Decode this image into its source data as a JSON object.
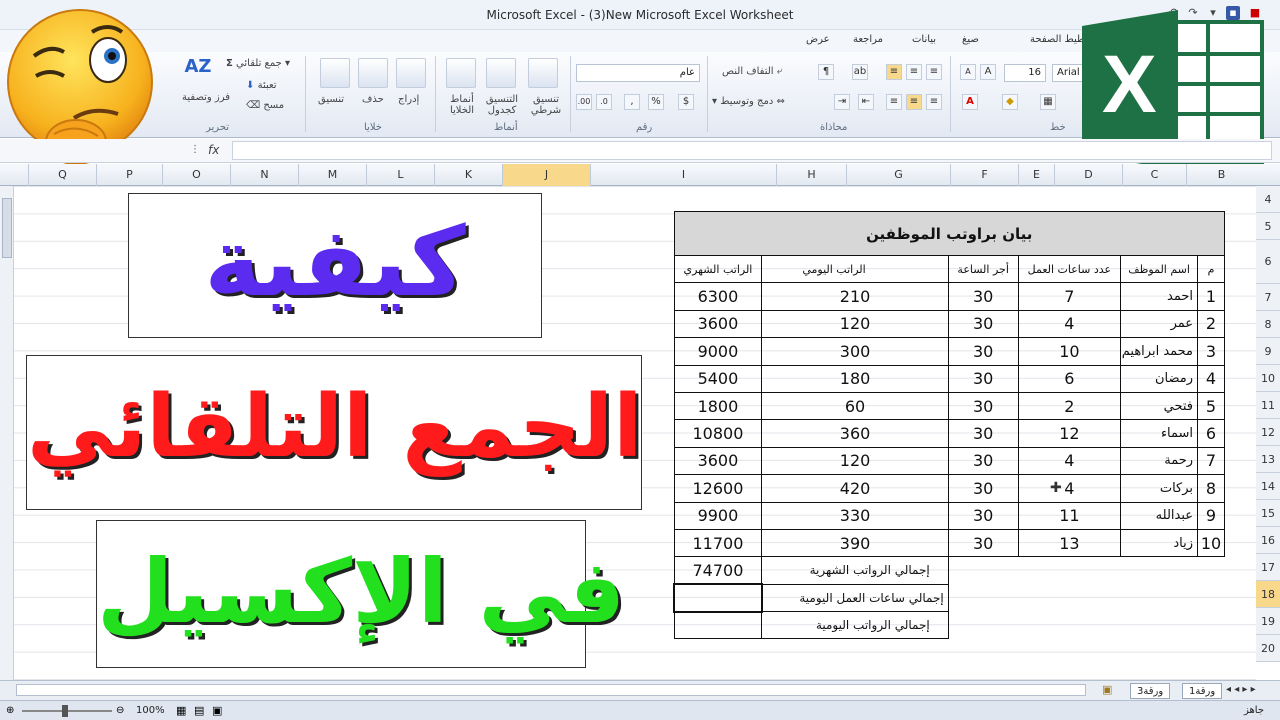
{
  "window": {
    "title": "Microsoft Excel - (3)New Microsoft Excel Worksheet"
  },
  "ribbon_tabs": [
    "تخطيط الصفحة",
    "صيغ",
    "بيانات",
    "مراجعة",
    "عرض"
  ],
  "ribbon": {
    "font": {
      "name": "Arial",
      "size": "16",
      "group": "خط"
    },
    "alignment": {
      "wrap": "التفاف النص",
      "merge": "دمج وتوسيط",
      "group": "محاذاة"
    },
    "number": {
      "format": "عام",
      "group": "رقم"
    },
    "styles": {
      "conditional": "تنسيق شرطي",
      "as_table": "التنسيق كجدول",
      "cell_styles": "أنماط الخلايا",
      "group": "أنماط"
    },
    "cells": {
      "insert": "إدراج",
      "delete": "حذف",
      "format": "تنسيق",
      "group": "خلايا"
    },
    "editing": {
      "autosum": "جمع تلقائي",
      "fill": "تعبئة",
      "clear": "مسح",
      "sort": "فرز وتصفية",
      "group": "تحرير"
    }
  },
  "formula_bar": {
    "fx": "fx",
    "value": ""
  },
  "columns": [
    "B",
    "C",
    "D",
    "E",
    "F",
    "G",
    "H",
    "I",
    "J",
    "K",
    "L",
    "M",
    "N",
    "O",
    "P",
    "Q"
  ],
  "selected_column": "J",
  "rows": [
    "4",
    "5",
    "6",
    "7",
    "8",
    "9",
    "10",
    "11",
    "12",
    "13",
    "14",
    "15",
    "16",
    "17",
    "18",
    "19",
    "20"
  ],
  "selected_row": "18",
  "table": {
    "title": "بيان براوتب الموظفين",
    "headers": [
      "م",
      "اسم الموظف",
      "عدد ساعات العمل",
      "أجر الساعة",
      "الراتب اليومي",
      "الراتب الشهري"
    ],
    "records": [
      [
        "1",
        "احمد",
        "7",
        "30",
        "210",
        "6300"
      ],
      [
        "2",
        "عمر",
        "4",
        "30",
        "120",
        "3600"
      ],
      [
        "3",
        "محمد ابراهيم",
        "10",
        "30",
        "300",
        "9000"
      ],
      [
        "4",
        "رمضان",
        "6",
        "30",
        "180",
        "5400"
      ],
      [
        "5",
        "فتحي",
        "2",
        "30",
        "60",
        "1800"
      ],
      [
        "6",
        "اسماء",
        "12",
        "30",
        "360",
        "10800"
      ],
      [
        "7",
        "رحمة",
        "4",
        "30",
        "120",
        "3600"
      ],
      [
        "8",
        "بركات",
        "4",
        "30",
        "420",
        "12600"
      ],
      [
        "9",
        "عبدالله",
        "11",
        "30",
        "330",
        "9900"
      ],
      [
        "10",
        "زياد",
        "13",
        "30",
        "390",
        "11700"
      ]
    ],
    "totals": [
      {
        "label": "إجمالي الرواتب الشهرية",
        "value": "74700"
      },
      {
        "label": "إجمالي ساعات العمل اليومية",
        "value": ""
      },
      {
        "label": "إجمالي الرواتب اليومية",
        "value": ""
      }
    ]
  },
  "headline": {
    "line1": "كيفية",
    "line2": "الجمع التلقائي",
    "line3": "في الإكسيل"
  },
  "colors": {
    "line1": "#5b2bf0",
    "line2": "#ff1b1b",
    "line3": "#22e01e",
    "excel_green": "#1e7145"
  },
  "logo": {
    "letter": "X"
  },
  "sheet_tabs": [
    "ورقة1",
    "ورقة3"
  ],
  "status": {
    "zoom": "100%",
    "ready": "جاهز"
  }
}
